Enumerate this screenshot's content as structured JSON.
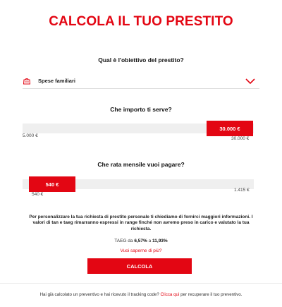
{
  "page": {
    "title": "CALCOLA IL TUO PRESTITO"
  },
  "purpose": {
    "question": "Qual è l'obiettivo del prestito?",
    "selected": "Spese familiari",
    "icon": "wallet-icon",
    "dropdown_icon": "chevron-down-icon"
  },
  "amount": {
    "question": "Che importo ti serve?",
    "value": "30.000 €",
    "min": "5.000 €",
    "max": "30.000 €",
    "level_fraction": 1.0
  },
  "installment": {
    "question": "Che rata mensile vuoi pagare?",
    "value": "540 €",
    "min": "540 €",
    "max": "1.415 €",
    "level_fraction": 0.0
  },
  "info": {
    "text": "Per personalizzare la tua richiesta di prestito personale ti chiediamo di fornirci maggiori informazioni. I valori di tan e taeg rimarranno espressi in range finché non avremo preso in carico e valutato la tua richiesta.",
    "taeg_prefix": "TAEG da ",
    "taeg_low": "6,57%",
    "taeg_mid": " a ",
    "taeg_high": "11,93%",
    "more_link": "Vuoi saperne di più?"
  },
  "cta": {
    "label": "CALCOLA"
  },
  "footer": {
    "text_before": "Hai già calcolato un preventivo e hai ricevuto il tracking code? ",
    "link": "Clicca qui",
    "text_after": " per recuperare il tuo preventivo."
  },
  "colors": {
    "accent": "#e30613",
    "track": "#efefef"
  }
}
